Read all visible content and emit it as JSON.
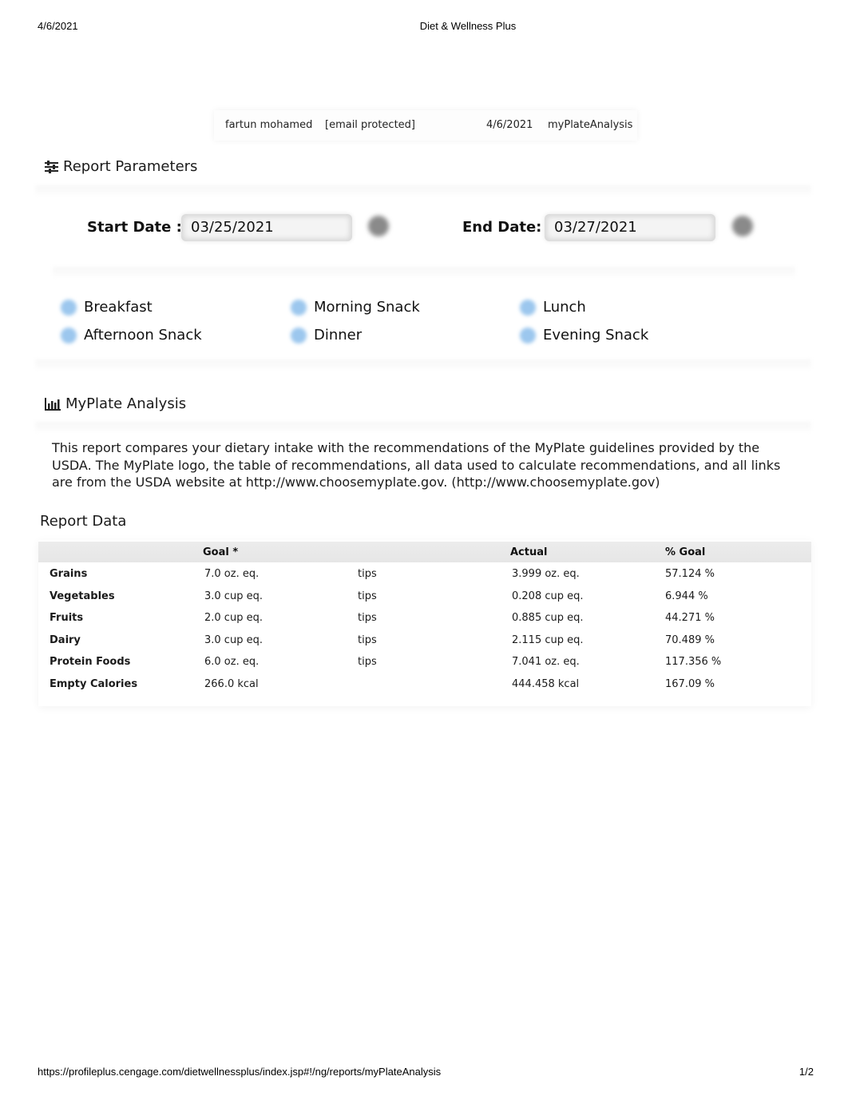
{
  "print_header": {
    "date": "4/6/2021",
    "title": "Diet & Wellness Plus"
  },
  "print_footer": {
    "url": "https://profileplus.cengage.com/dietwellnessplus/index.jsp#!/ng/reports/myPlateAnalysis",
    "page": "1/2"
  },
  "user_bar": {
    "name": "fartun mohamed",
    "email": "[email protected]",
    "date": "4/6/2021",
    "report": "myPlateAnalysis"
  },
  "report_parameters": {
    "title": "Report Parameters",
    "icon": "sliders-icon",
    "start_label": "Start Date :",
    "start_value": "03/25/2021",
    "end_label": "End Date:",
    "end_value": "03/27/2021",
    "meals": [
      "Breakfast",
      "Morning Snack",
      "Lunch",
      "Afternoon Snack",
      "Dinner",
      "Evening Snack"
    ]
  },
  "myplate": {
    "title": "MyPlate Analysis",
    "icon": "bar-chart-icon",
    "description": "This report compares your dietary intake with the recommendations of the MyPlate guidelines provided by the USDA. The MyPlate logo, the table of recommendations, all data used to calculate recommendations, and all links are from the USDA website at http://www.choosemyplate.gov. (http://www.choosemyplate.gov)"
  },
  "report_data": {
    "title": "Report Data",
    "columns": [
      "",
      "Goal *",
      "",
      "Actual",
      "% Goal"
    ],
    "rows": [
      [
        "Grains",
        "7.0 oz. eq.",
        "tips",
        "3.999 oz. eq.",
        "57.124 %"
      ],
      [
        "Vegetables",
        "3.0 cup eq.",
        "tips",
        "0.208 cup eq.",
        "6.944 %"
      ],
      [
        "Fruits",
        "2.0 cup eq.",
        "tips",
        "0.885 cup eq.",
        "44.271 %"
      ],
      [
        "Dairy",
        "3.0 cup eq.",
        "tips",
        "2.115 cup eq.",
        "70.489 %"
      ],
      [
        "Protein Foods",
        "6.0 oz. eq.",
        "tips",
        "7.041 oz. eq.",
        "117.356 %"
      ],
      [
        "Empty Calories",
        "266.0 kcal",
        "",
        "444.458 kcal",
        "167.09 %"
      ]
    ]
  }
}
